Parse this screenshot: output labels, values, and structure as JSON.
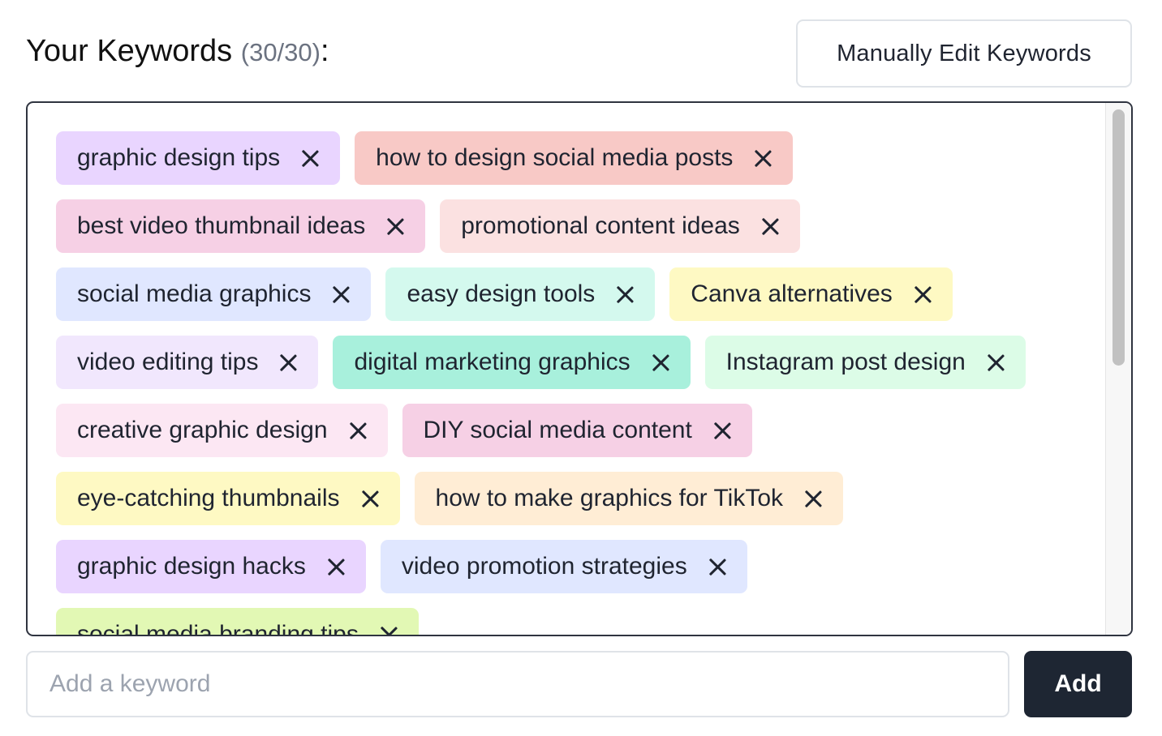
{
  "header": {
    "title": "Your Keywords",
    "count": "(30/30)",
    "colon": ":",
    "edit_button_label": "Manually Edit Keywords"
  },
  "keywords": [
    {
      "label": "graphic design tips",
      "color": "#e9d5ff"
    },
    {
      "label": "how to design social media posts",
      "color": "#f8c9c6"
    },
    {
      "label": "best video thumbnail ideas",
      "color": "#f6d0e5"
    },
    {
      "label": "promotional content ideas",
      "color": "#fbe1e1"
    },
    {
      "label": "social media graphics",
      "color": "#e0e7ff"
    },
    {
      "label": "easy design tools",
      "color": "#d4f9ee"
    },
    {
      "label": "Canva alternatives",
      "color": "#fef9c3"
    },
    {
      "label": "video editing tips",
      "color": "#f1e7fd"
    },
    {
      "label": "digital marketing graphics",
      "color": "#a8f0dc"
    },
    {
      "label": "Instagram post design",
      "color": "#dcfce7"
    },
    {
      "label": "creative graphic design",
      "color": "#fce7f3"
    },
    {
      "label": "DIY social media content",
      "color": "#f6d0e5"
    },
    {
      "label": "eye-catching thumbnails",
      "color": "#fef9c3"
    },
    {
      "label": "how to make graphics for TikTok",
      "color": "#ffedd5"
    },
    {
      "label": "graphic design hacks",
      "color": "#e9d5ff"
    },
    {
      "label": "video promotion strategies",
      "color": "#e0e7ff"
    },
    {
      "label": "social media branding tips",
      "color": "#e2f8b4"
    }
  ],
  "input": {
    "placeholder": "Add a keyword",
    "value": ""
  },
  "add_button_label": "Add"
}
